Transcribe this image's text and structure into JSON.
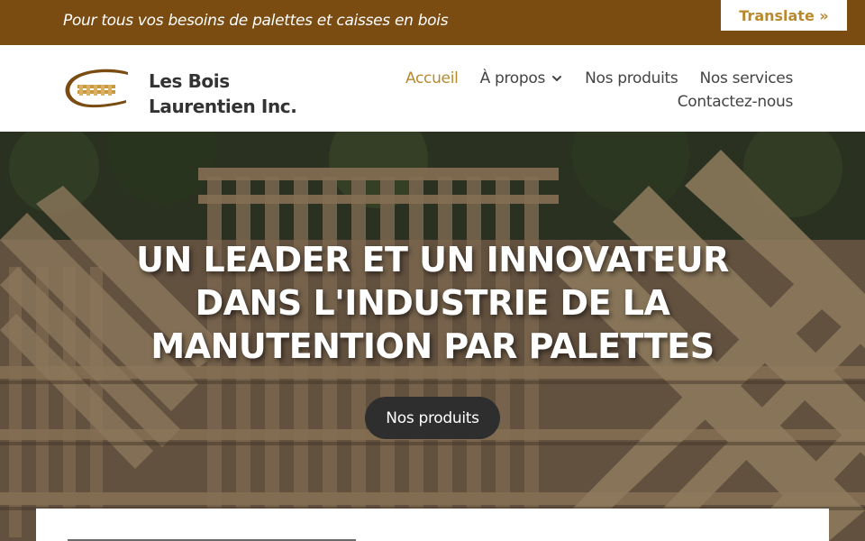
{
  "topbar": {
    "tagline": "Pour tous vos besoins de palettes et caisses en bois",
    "translate_label": "Translate »"
  },
  "header": {
    "brand_name": "Les Bois Laurentien Inc.",
    "nav": [
      {
        "label": "Accueil",
        "active": true
      },
      {
        "label": "À propos",
        "has_dropdown": true
      },
      {
        "label": "Nos produits"
      },
      {
        "label": "Nos services"
      },
      {
        "label": "Contactez-nous"
      }
    ]
  },
  "hero": {
    "title": "UN LEADER ET UN INNOVATEUR DANS L'INDUSTRIE DE LA MANUTENTION PAR PALETTES",
    "button_label": "Nos produits"
  },
  "colors": {
    "topbar": "#7a4c12",
    "accent": "#b88a2e",
    "button_dark": "#2e2e2e"
  }
}
